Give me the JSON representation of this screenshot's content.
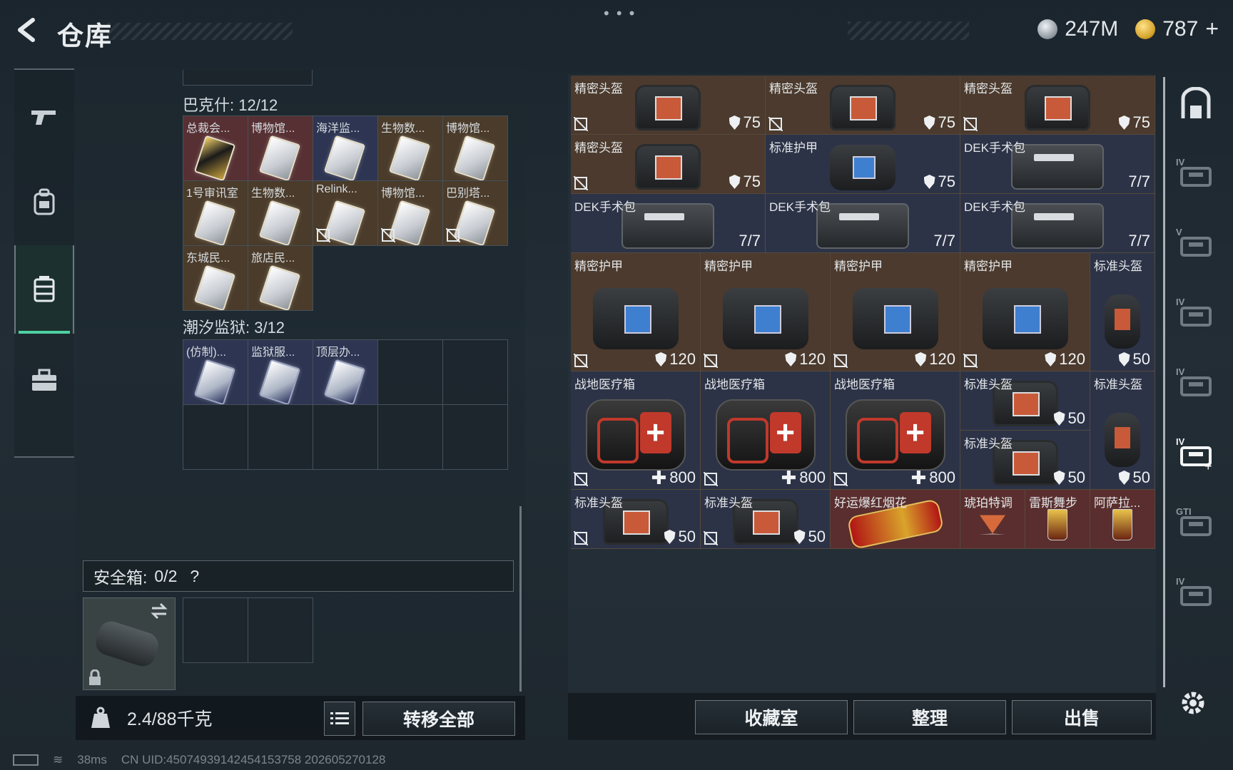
{
  "header": {
    "title": "仓库",
    "currencies": [
      {
        "name": "silver-coin-icon",
        "value": "247M"
      },
      {
        "name": "gold-coin-icon",
        "value": "787"
      }
    ],
    "add_label": "+"
  },
  "left_sidebar": {
    "items": [
      {
        "name": "pistol-icon",
        "active": false
      },
      {
        "name": "backpack-icon",
        "active": false
      },
      {
        "name": "storage-case-icon",
        "active": true
      },
      {
        "name": "toolbox-icon",
        "active": false
      }
    ]
  },
  "left_panel": {
    "sections": [
      {
        "label": "巴克什: 12/12",
        "cells": [
          {
            "name": "总裁会...",
            "bg": "red",
            "card": "gold",
            "lock": false
          },
          {
            "name": "博物馆...",
            "bg": "red",
            "card": "white",
            "lock": false
          },
          {
            "name": "海洋监...",
            "bg": "blue",
            "card": "white",
            "lock": false
          },
          {
            "name": "生物数...",
            "bg": "gold",
            "card": "white",
            "lock": false
          },
          {
            "name": "博物馆...",
            "bg": "gold",
            "card": "white",
            "lock": false
          },
          {
            "name": "1号审讯室",
            "bg": "gold",
            "card": "white",
            "lock": false
          },
          {
            "name": "生物数...",
            "bg": "gold",
            "card": "white",
            "lock": false
          },
          {
            "name": "Relink...",
            "bg": "gold",
            "card": "white",
            "lock": true
          },
          {
            "name": "博物馆...",
            "bg": "gold",
            "card": "white",
            "lock": true
          },
          {
            "name": "巴别塔...",
            "bg": "gold",
            "card": "white",
            "lock": true
          },
          {
            "name": "东城民...",
            "bg": "gold",
            "card": "white",
            "lock": false
          },
          {
            "name": "旅店民...",
            "bg": "gold",
            "card": "white",
            "lock": false
          }
        ]
      },
      {
        "label": "潮汐监狱: 3/12",
        "cells": [
          {
            "name": "(仿制)...",
            "bg": "blue",
            "card": "dark",
            "lock": false
          },
          {
            "name": "监狱服...",
            "bg": "blue",
            "card": "dark",
            "lock": false
          },
          {
            "name": "顶层办...",
            "bg": "blue",
            "card": "dark",
            "lock": false
          }
        ]
      }
    ],
    "safe_box": {
      "label": "安全箱:",
      "value": "0/2",
      "help": "?"
    },
    "weight": "2.4/88千克",
    "transfer_all_label": "转移全部"
  },
  "stash_items": [
    {
      "name": "精密头盔",
      "type": "helmet",
      "bg": "br",
      "value": "75",
      "stat": "shield",
      "lock": true
    },
    {
      "name": "精密头盔",
      "type": "helmet",
      "bg": "br",
      "value": "75",
      "stat": "shield",
      "lock": true
    },
    {
      "name": "精密头盔",
      "type": "helmet",
      "bg": "br",
      "value": "75",
      "stat": "shield",
      "lock": true
    },
    {
      "name": "精密头盔",
      "type": "helmet",
      "bg": "br",
      "value": "75",
      "stat": "shield",
      "lock": true
    },
    {
      "name": "标准护甲",
      "type": "vest-sm",
      "bg": "nv",
      "value": "75",
      "stat": "shield",
      "lock": false
    },
    {
      "name": "DEK手术包",
      "type": "surgery",
      "bg": "nv",
      "value": "7/7",
      "stat": "none",
      "lock": false
    },
    {
      "name": "DEK手术包",
      "type": "surgery",
      "bg": "nv",
      "value": "7/7",
      "stat": "none",
      "lock": false
    },
    {
      "name": "DEK手术包",
      "type": "surgery",
      "bg": "nv",
      "value": "7/7",
      "stat": "none",
      "lock": false
    },
    {
      "name": "DEK手术包",
      "type": "surgery",
      "bg": "nv",
      "value": "7/7",
      "stat": "none",
      "lock": false
    },
    {
      "name": "精密护甲",
      "type": "vest",
      "bg": "br",
      "value": "120",
      "stat": "shield",
      "lock": true
    },
    {
      "name": "精密护甲",
      "type": "vest",
      "bg": "br",
      "value": "120",
      "stat": "shield",
      "lock": true
    },
    {
      "name": "精密护甲",
      "type": "vest",
      "bg": "br",
      "value": "120",
      "stat": "shield",
      "lock": true
    },
    {
      "name": "精密护甲",
      "type": "vest",
      "bg": "br",
      "value": "120",
      "stat": "shield",
      "lock": true
    },
    {
      "name": "标准头盔",
      "type": "helm-tall",
      "bg": "nv",
      "value": "50",
      "stat": "shield",
      "lock": false
    },
    {
      "name": "战地医疗箱",
      "type": "medkit",
      "bg": "nv",
      "value": "800",
      "stat": "plus",
      "lock": true
    },
    {
      "name": "战地医疗箱",
      "type": "medkit",
      "bg": "nv",
      "value": "800",
      "stat": "plus",
      "lock": true
    },
    {
      "name": "战地医疗箱",
      "type": "medkit",
      "bg": "nv",
      "value": "800",
      "stat": "plus",
      "lock": true
    },
    {
      "name": "标准头盔",
      "type": "helmet",
      "bg": "nv",
      "value": "50",
      "stat": "shield",
      "lock": false
    },
    {
      "name": "标准头盔",
      "type": "helm-tall",
      "bg": "nv",
      "value": "50",
      "stat": "shield",
      "lock": false
    },
    {
      "name": "标准头盔",
      "type": "helmet",
      "bg": "nv",
      "value": "50",
      "stat": "shield",
      "lock": false
    },
    {
      "name": "标准头盔",
      "type": "helmet",
      "bg": "nv",
      "value": "50",
      "stat": "shield",
      "lock": true
    },
    {
      "name": "标准头盔",
      "type": "helmet",
      "bg": "nv",
      "value": "50",
      "stat": "shield",
      "lock": true
    },
    {
      "name": "好运爆红烟花",
      "type": "firework",
      "bg": "rd",
      "value": "",
      "stat": "none",
      "lock": false
    },
    {
      "name": "琥珀特调",
      "type": "cocktail",
      "bg": "rd",
      "value": "",
      "stat": "none",
      "lock": false
    },
    {
      "name": "雷斯舞步",
      "type": "drink",
      "bg": "rd",
      "value": "",
      "stat": "none",
      "lock": false
    },
    {
      "name": "阿萨拉...",
      "type": "drink",
      "bg": "rd",
      "value": "",
      "stat": "none",
      "lock": false
    }
  ],
  "right_sidebar": {
    "items": [
      {
        "name": "storage-room-icon",
        "label": ""
      },
      {
        "name": "case-tier-icon",
        "label": "IV"
      },
      {
        "name": "case-tier-icon",
        "label": "V"
      },
      {
        "name": "case-tier-icon",
        "label": "IV"
      },
      {
        "name": "case-tier-icon",
        "label": "IV"
      },
      {
        "name": "case-add-icon",
        "label": "IV"
      },
      {
        "name": "case-tier-icon",
        "label": "GTI"
      },
      {
        "name": "case-tier-icon",
        "label": "IV"
      }
    ]
  },
  "bottom_buttons": {
    "collection": "收藏室",
    "organize": "整理",
    "sell": "出售"
  },
  "status_bar": {
    "ping": "38ms",
    "uid": "CN UID:4507493914245415375​8 202605270128"
  },
  "colors": {
    "accent": "#4fd1a2",
    "brown_cell": "#4b3a2d",
    "navy_cell": "#2c3347",
    "red_cell": "#5a2e2e"
  }
}
